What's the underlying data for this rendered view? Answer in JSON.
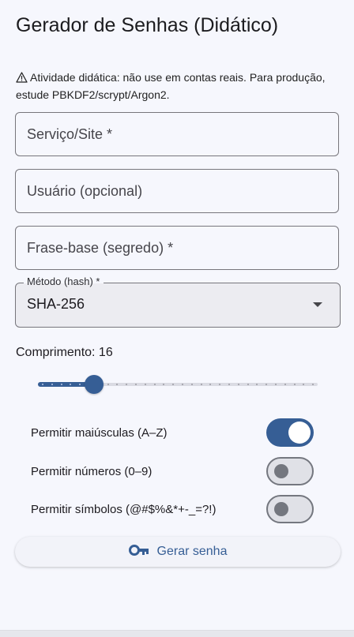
{
  "app": {
    "title": "Gerador de Senhas (Didático)"
  },
  "warning": {
    "icon": "warning-icon",
    "text": "Atividade didática: não use em contas reais. Para produção, estude PBKDF2/scrypt/Argon2."
  },
  "fields": {
    "service": {
      "placeholder": "Serviço/Site *",
      "value": ""
    },
    "user": {
      "placeholder": "Usuário (opcional)",
      "value": ""
    },
    "passphrase": {
      "placeholder": "Frase-base (segredo) *",
      "value": ""
    }
  },
  "method": {
    "label": "Método (hash) *",
    "selected": "SHA-256"
  },
  "length": {
    "label": "Comprimento: 16",
    "value": 16,
    "min": 4,
    "max": 64
  },
  "toggles": [
    {
      "label": "Permitir maiúsculas (A–Z)",
      "on": true
    },
    {
      "label": "Permitir números (0–9)",
      "on": false
    },
    {
      "label": "Permitir símbolos (@#$%&*+-_=?!)",
      "on": false
    }
  ],
  "generate_button": {
    "label": "Gerar senha",
    "icon": "key-icon"
  },
  "colors": {
    "accent": "#365e95",
    "background": "#f6f7fd"
  }
}
